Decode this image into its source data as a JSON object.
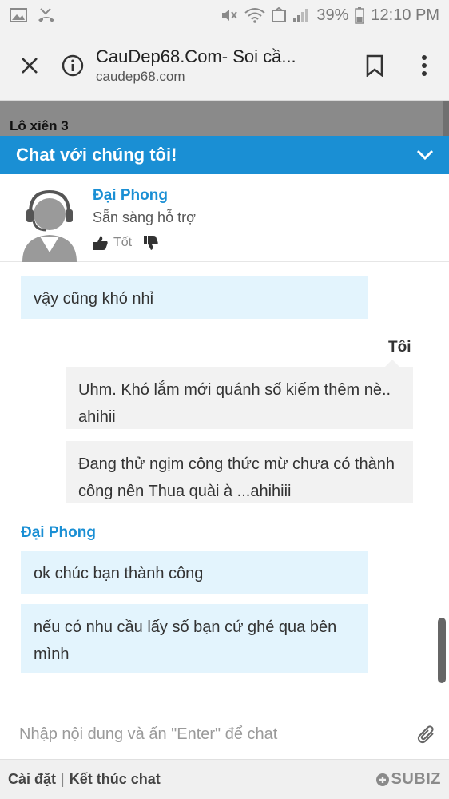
{
  "status_bar": {
    "battery": "39%",
    "time": "12:10 PM",
    "left_icons": [
      "image-icon",
      "missed-call-icon"
    ],
    "right_icons": [
      "mute-icon",
      "wifi-icon",
      "signal-icon",
      "battery-icon"
    ]
  },
  "browser": {
    "title": "CauDep68.Com- Soi cầ...",
    "url": "caudep68.com"
  },
  "background_page": {
    "text": "Lô xiên 3"
  },
  "chat": {
    "header_title": "Chat với chúng tôi!",
    "accent_color": "#1a8fd4",
    "agent": {
      "name": "Đại Phong",
      "status": "Sẵn sàng hỗ trợ",
      "rate_good_label": "Tốt"
    },
    "messages": [
      {
        "from": "agent",
        "text": "vậy cũng khó nhỉ"
      },
      {
        "from": "me",
        "sender_label": "Tôi",
        "text": "Uhm. Khó lắm mới quánh số kiếm thêm nè.. ahihii"
      },
      {
        "from": "me",
        "text": "Đang thử ngịm công thức mừ chưa có thành công nên Thua quài à ...ahihiii"
      },
      {
        "from": "agent",
        "sender_label": "Đại Phong",
        "text": "ok chúc bạn thành công"
      },
      {
        "from": "agent",
        "text": "nếu có nhu cầu lấy số bạn cứ ghé qua bên mình"
      }
    ],
    "input_placeholder": "Nhập nội dung và ấn \"Enter\" để chat",
    "footer": {
      "settings_label": "Cài đặt",
      "separator": "|",
      "end_chat_label": "Kết thúc chat",
      "brand": "SUBIZ"
    }
  }
}
